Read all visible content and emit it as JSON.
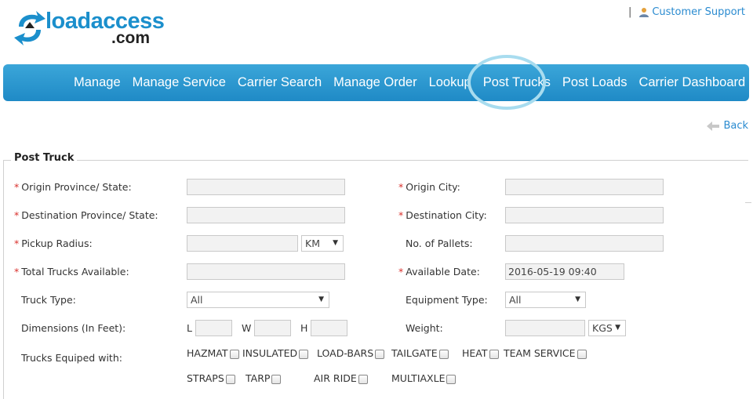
{
  "header": {
    "logo_main": "loadaccess",
    "logo_sub": ".com",
    "separator": "|",
    "customer_support": "Customer Support"
  },
  "nav": {
    "items": [
      "Manage",
      "Manage Service",
      "Carrier Search",
      "Manage Order",
      "Lookup",
      "Post Trucks",
      "Post Loads",
      "Carrier Dashboard"
    ],
    "highlighted": "Post Trucks"
  },
  "back_label": "Back",
  "form": {
    "legend": "Post Truck",
    "required_mark": "*",
    "origin_state_label": "Origin Province/ State:",
    "origin_city_label": "Origin City:",
    "dest_state_label": "Destination Province/ State:",
    "dest_city_label": "Destination City:",
    "pickup_radius_label": "Pickup Radius:",
    "radius_unit": "KM",
    "pallets_label": "No. of Pallets:",
    "total_trucks_label": "Total Trucks Available:",
    "available_date_label": "Available Date:",
    "available_date_value": "2016-05-19 09:40",
    "truck_type_label": "Truck Type:",
    "truck_type_value": "All",
    "equipment_type_label": "Equipment Type:",
    "equipment_type_value": "All",
    "dimensions_label": "Dimensions (In Feet):",
    "dim_l": "L",
    "dim_w": "W",
    "dim_h": "H",
    "weight_label": "Weight:",
    "weight_unit": "KGS",
    "equipped_label": "Trucks Equiped with:",
    "equipment_options": [
      "HAZMAT",
      "INSULATED",
      "LOAD-BARS",
      "TAILGATE",
      "HEAT",
      "TEAM SERVICE",
      "STRAPS",
      "TARP",
      "AIR RIDE",
      "MULTIAXLE"
    ]
  },
  "colors": {
    "brand_blue": "#1b8fcc",
    "nav_top": "#3ba6d9",
    "nav_bottom": "#1f8ac6",
    "link": "#2a8bd0",
    "required": "#d9302c",
    "highlight_ring": "#a8dcef"
  }
}
